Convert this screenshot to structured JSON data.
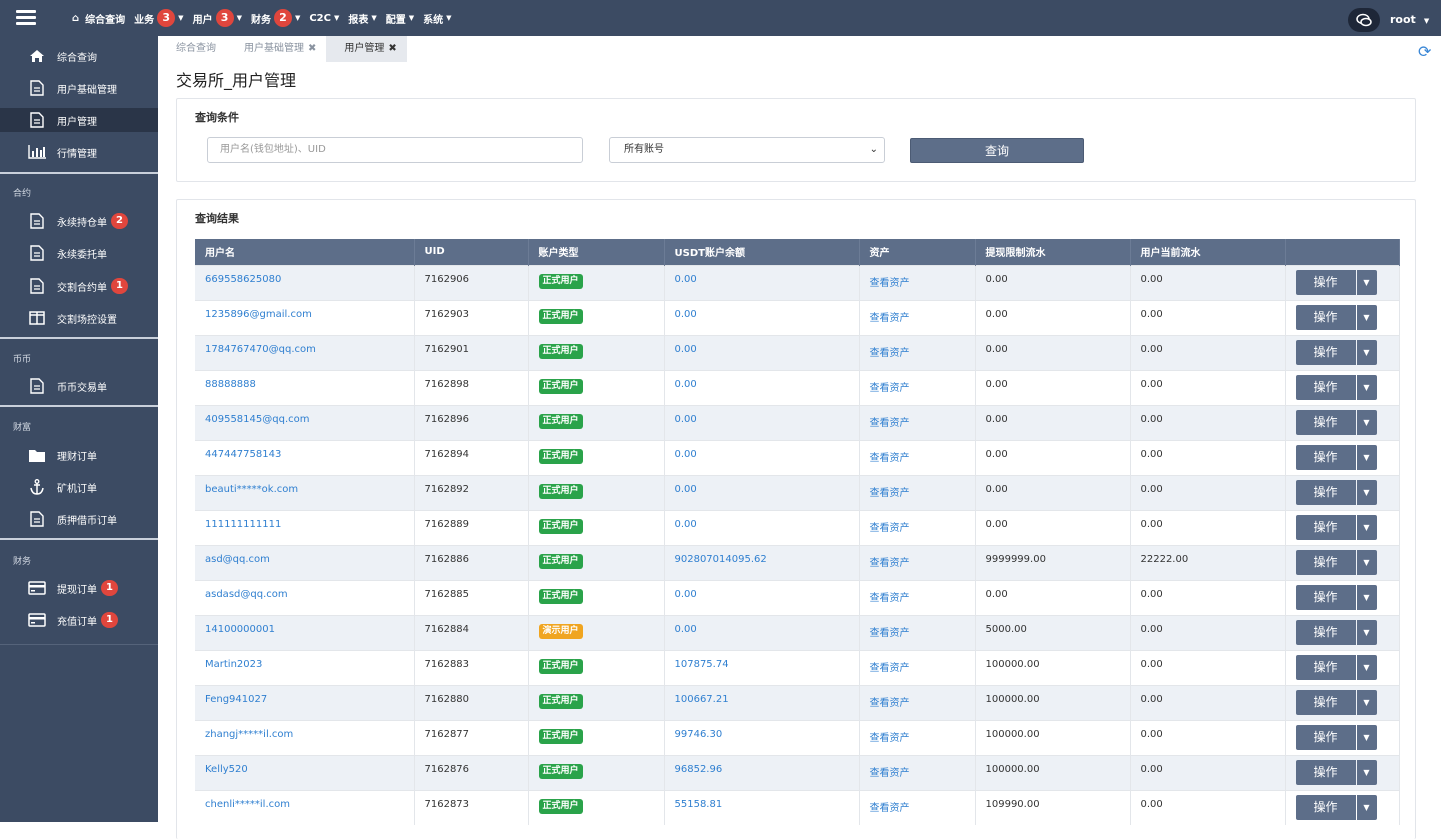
{
  "topnav": {
    "items": [
      {
        "label": "综合查询",
        "badge": "",
        "caret": false
      },
      {
        "label": "业务",
        "badge": "3",
        "caret": true
      },
      {
        "label": "用户",
        "badge": "3",
        "caret": true
      },
      {
        "label": "财务",
        "badge": "2",
        "caret": true
      },
      {
        "label": "C2C",
        "badge": "",
        "caret": true
      },
      {
        "label": "报表",
        "badge": "",
        "caret": true
      },
      {
        "label": "配置",
        "badge": "",
        "caret": true
      },
      {
        "label": "系统",
        "badge": "",
        "caret": true
      }
    ],
    "user": "root"
  },
  "sidebar": {
    "top_items": [
      {
        "label": "综合查询",
        "icon": "home-icon"
      },
      {
        "label": "用户基础管理",
        "icon": "document-icon"
      },
      {
        "label": "用户管理",
        "icon": "document-icon",
        "active": true
      },
      {
        "label": "行情管理",
        "icon": "bar-chart-icon"
      }
    ],
    "contract_label": "合约",
    "contract_items": [
      {
        "label": "永续持仓单",
        "badge": "2"
      },
      {
        "label": "永续委托单",
        "badge": ""
      },
      {
        "label": "交割合约单",
        "badge": "1"
      },
      {
        "label": "交割场控设置",
        "badge": ""
      }
    ],
    "spot_label": "币币",
    "spot_items": [
      {
        "label": "币币交易单"
      }
    ],
    "wealth_label": "财富",
    "wealth_items": [
      {
        "label": "理财订单"
      },
      {
        "label": "矿机订单"
      },
      {
        "label": "质押借币订单"
      }
    ],
    "finance_label": "财务",
    "finance_items": [
      {
        "label": "提现订单",
        "badge": "1"
      },
      {
        "label": "充值订单",
        "badge": "1"
      }
    ]
  },
  "tabs": [
    {
      "label": "综合查询",
      "closable": false
    },
    {
      "label": "用户基础管理",
      "closable": true
    },
    {
      "label": "用户管理",
      "closable": true,
      "active": true
    }
  ],
  "page_title": "交易所_用户管理",
  "query": {
    "title": "查询条件",
    "placeholder": "用户名(钱包地址)、UID",
    "select_value": "所有账号",
    "button": "查询"
  },
  "results": {
    "title": "查询结果",
    "columns": [
      "用户名",
      "UID",
      "账户类型",
      "USDT账户余额",
      "资产",
      "提现限制流水",
      "用户当前流水",
      ""
    ],
    "action_label": "操作",
    "rows": [
      {
        "user": "669558625080",
        "uid": "7162906",
        "type": "正式用户",
        "balance": "0.00",
        "asset": "查看资产",
        "limit": "0.00",
        "current": "0.00"
      },
      {
        "user": "1235896@gmail.com",
        "uid": "7162903",
        "type": "正式用户",
        "balance": "0.00",
        "asset": "查看资产",
        "limit": "0.00",
        "current": "0.00"
      },
      {
        "user": "1784767470@qq.com",
        "uid": "7162901",
        "type": "正式用户",
        "balance": "0.00",
        "asset": "查看资产",
        "limit": "0.00",
        "current": "0.00"
      },
      {
        "user": "88888888",
        "uid": "7162898",
        "type": "正式用户",
        "balance": "0.00",
        "asset": "查看资产",
        "limit": "0.00",
        "current": "0.00"
      },
      {
        "user": "409558145@qq.com",
        "uid": "7162896",
        "type": "正式用户",
        "balance": "0.00",
        "asset": "查看资产",
        "limit": "0.00",
        "current": "0.00"
      },
      {
        "user": "447447758143",
        "uid": "7162894",
        "type": "正式用户",
        "balance": "0.00",
        "asset": "查看资产",
        "limit": "0.00",
        "current": "0.00"
      },
      {
        "user": "beauti*****ok.com",
        "uid": "7162892",
        "type": "正式用户",
        "balance": "0.00",
        "asset": "查看资产",
        "limit": "0.00",
        "current": "0.00"
      },
      {
        "user": "111111111111",
        "uid": "7162889",
        "type": "正式用户",
        "balance": "0.00",
        "asset": "查看资产",
        "limit": "0.00",
        "current": "0.00"
      },
      {
        "user": "asd@qq.com",
        "uid": "7162886",
        "type": "正式用户",
        "balance": "902807014095.62",
        "asset": "查看资产",
        "limit": "9999999.00",
        "current": "22222.00"
      },
      {
        "user": "asdasd@qq.com",
        "uid": "7162885",
        "type": "正式用户",
        "balance": "0.00",
        "asset": "查看资产",
        "limit": "0.00",
        "current": "0.00"
      },
      {
        "user": "14100000001",
        "uid": "7162884",
        "type": "演示用户",
        "balance": "0.00",
        "asset": "查看资产",
        "limit": "5000.00",
        "current": "0.00"
      },
      {
        "user": "Martin2023",
        "uid": "7162883",
        "type": "正式用户",
        "balance": "107875.74",
        "asset": "查看资产",
        "limit": "100000.00",
        "current": "0.00"
      },
      {
        "user": "Feng941027",
        "uid": "7162880",
        "type": "正式用户",
        "balance": "100667.21",
        "asset": "查看资产",
        "limit": "100000.00",
        "current": "0.00"
      },
      {
        "user": "zhangj*****il.com",
        "uid": "7162877",
        "type": "正式用户",
        "balance": "99746.30",
        "asset": "查看资产",
        "limit": "100000.00",
        "current": "0.00"
      },
      {
        "user": "Kelly520",
        "uid": "7162876",
        "type": "正式用户",
        "balance": "96852.96",
        "asset": "查看资产",
        "limit": "100000.00",
        "current": "0.00"
      },
      {
        "user": "chenli*****il.com",
        "uid": "7162873",
        "type": "正式用户",
        "balance": "55158.81",
        "asset": "查看资产",
        "limit": "109990.00",
        "current": "0.00"
      }
    ]
  }
}
